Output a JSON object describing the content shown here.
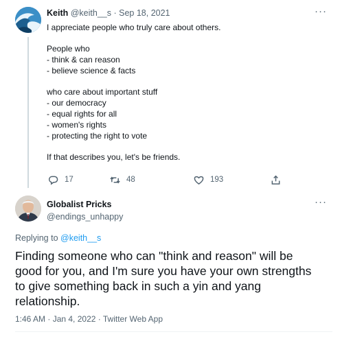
{
  "parent_tweet": {
    "author_name": "Keith",
    "author_handle": "@keith__s",
    "separator": "·",
    "date": "Sep 18, 2021",
    "more_glyph": "···",
    "body_lines": [
      "I appreciate people who truly care about others.",
      "",
      "People who",
      "- think & can reason",
      "- believe science & facts",
      "",
      "who care about important stuff",
      "- our democracy",
      "- equal rights for all",
      "- women's rights",
      "- protecting the right to vote",
      "",
      "If that describes you, let's be friends."
    ],
    "reply_count": "17",
    "retweet_count": "48",
    "like_count": "193",
    "icons": [
      "reply-icon",
      "retweet-icon",
      "like-icon",
      "share-icon"
    ]
  },
  "reply_tweet": {
    "author_name": "Globalist Pricks",
    "author_handle": "@endings_unhappy",
    "more_glyph": "···",
    "replying_to_label": "Replying to",
    "replying_to_handle": "@keith__s",
    "body_lines": [
      "Finding someone who can \"think and reason\" will be",
      "good for you, and I'm sure you have your own strengths",
      "to give something back in such a yin and yang",
      "relationship."
    ],
    "timestamp": "1:46 AM · Jan 4, 2022 · Twitter Web App"
  },
  "colors": {
    "text": "#0f1419",
    "secondary": "#536471",
    "link": "#1d9bf0",
    "thread_line": "#cfd9de"
  }
}
